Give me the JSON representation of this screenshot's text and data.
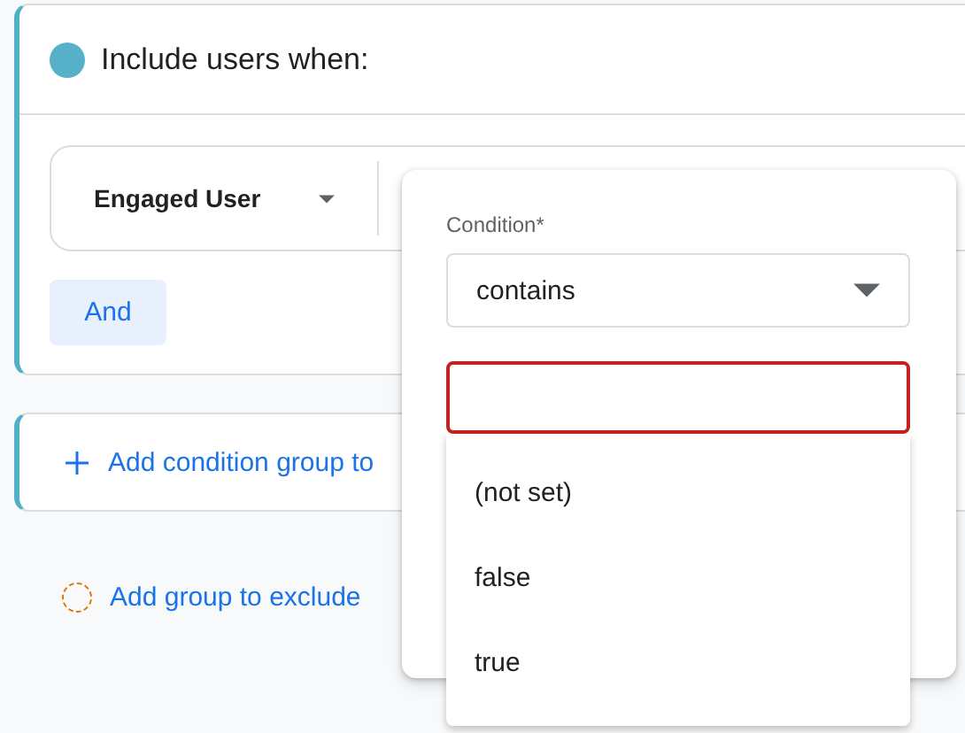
{
  "include_group": {
    "title": "Include users when:",
    "condition": {
      "dimension": "Engaged User"
    },
    "and_button": "And"
  },
  "add_condition_group": {
    "label": "Add condition group to"
  },
  "add_exclude_group": {
    "label": "Add group to exclude"
  },
  "condition_popup": {
    "label": "Condition*",
    "operator": "contains",
    "value_field": {
      "error": true
    },
    "options": [
      {
        "label": "(not set)"
      },
      {
        "label": "false"
      },
      {
        "label": "true"
      }
    ]
  }
}
